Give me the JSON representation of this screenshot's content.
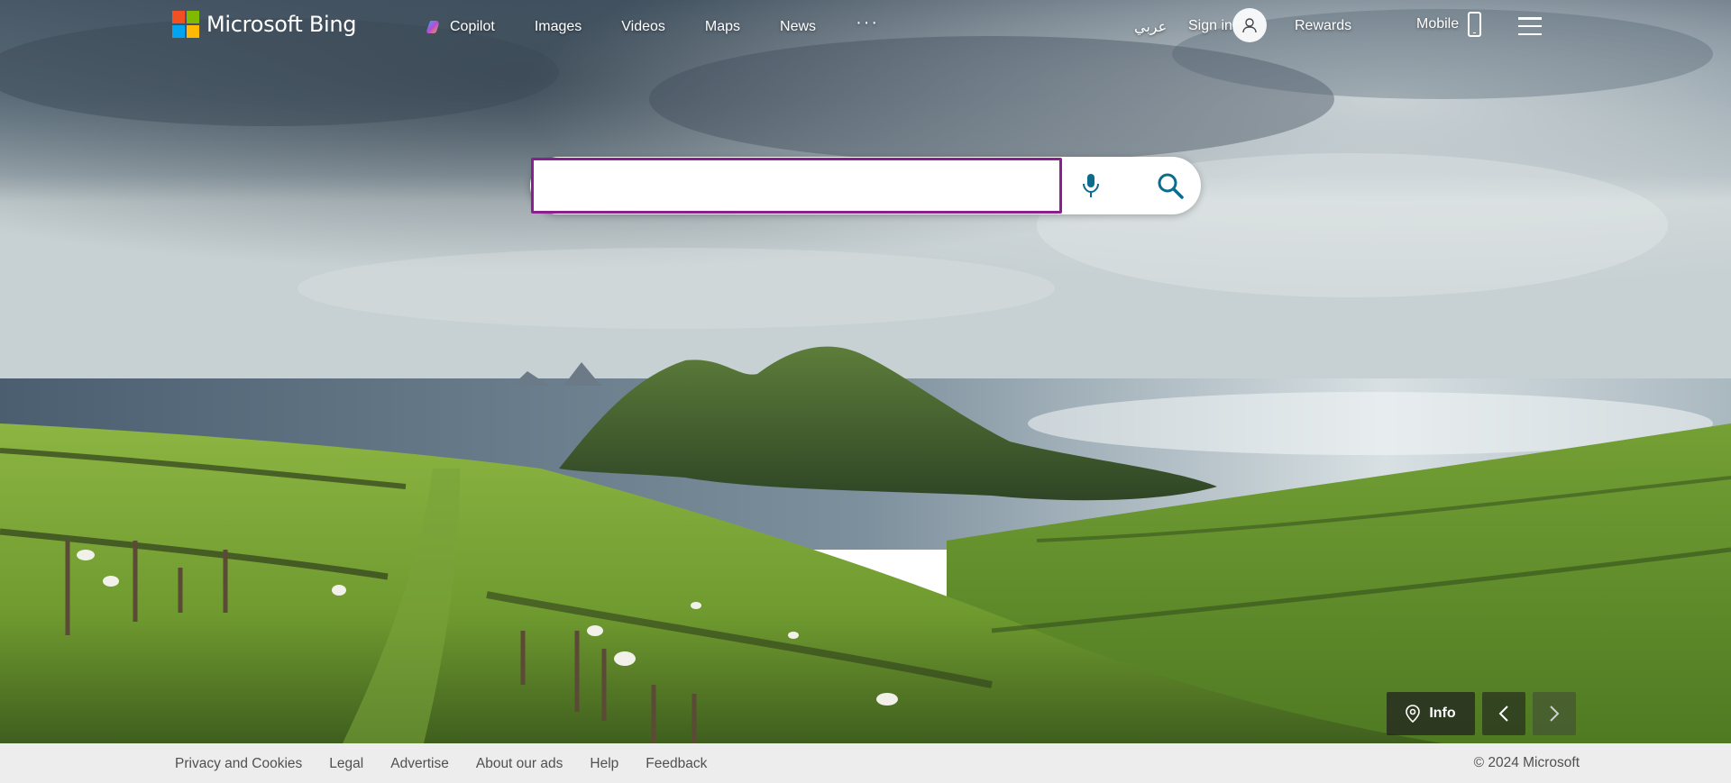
{
  "brand": {
    "name": "Microsoft Bing",
    "colors": {
      "red": "#f25022",
      "green": "#7fba00",
      "blue": "#00a4ef",
      "yellow": "#ffb900"
    }
  },
  "nav": {
    "items": [
      {
        "label": "Copilot",
        "icon": "copilot-icon"
      },
      {
        "label": "Images"
      },
      {
        "label": "Videos"
      },
      {
        "label": "Maps"
      },
      {
        "label": "News"
      }
    ],
    "more": "···"
  },
  "right_nav": {
    "language": "عربي",
    "sign_in": "Sign in",
    "rewards": "Rewards",
    "mobile": "Mobile"
  },
  "search": {
    "value": "",
    "placeholder": "",
    "focus_color": "#8a1f8e"
  },
  "image_controls": {
    "info_label": "Info"
  },
  "footer": {
    "links": [
      "Privacy and Cookies",
      "Legal",
      "Advertise",
      "About our ads",
      "Help",
      "Feedback"
    ],
    "copyright": "© 2024 Microsoft"
  }
}
